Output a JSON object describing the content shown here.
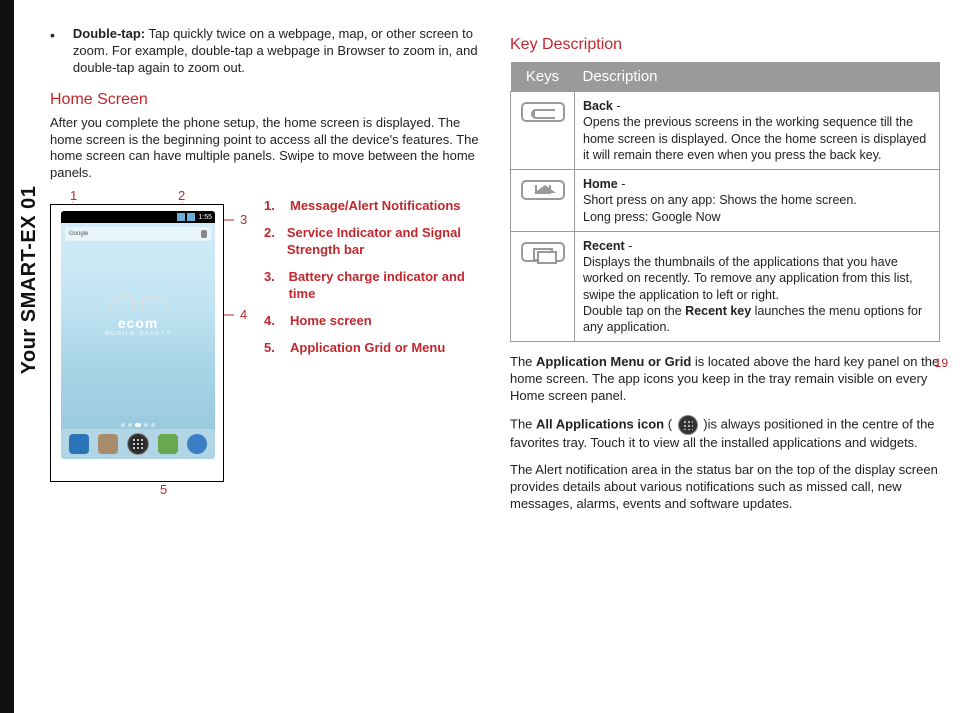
{
  "sidebar_label": "Your SMART-EX 01",
  "page_number": "19",
  "left": {
    "bullet": {
      "label": "Double-tap:",
      "text": " Tap quickly twice on a webpage, map, or other screen to zoom. For example, double-tap a webpage in Browser to zoom in, and double-tap again to zoom out."
    },
    "home_screen_heading": "Home Screen",
    "home_screen_body": "After you complete the phone setup, the home screen is displayed. The home screen is the beginning point to access all the device's features. The home screen can have multiple panels. Swipe to move between the home panels.",
    "callouts": {
      "c1": "1",
      "c2": "2",
      "c3": "3",
      "c4": "4",
      "c5": "5"
    },
    "phone": {
      "google_label": "Google",
      "brand": "ecom",
      "brand_tag": "MOBILE SAFETY",
      "time": "1:55"
    },
    "legend": [
      {
        "num": "1.",
        "text": "Message/Alert Notifications"
      },
      {
        "num": "2.",
        "text": "Service Indicator and Signal Strength bar"
      },
      {
        "num": "3.",
        "text": "Battery charge indicator and time"
      },
      {
        "num": "4.",
        "text": "Home screen"
      },
      {
        "num": "5.",
        "text": "Application Grid or Menu"
      }
    ]
  },
  "right": {
    "heading": "Key Description",
    "table": {
      "head_keys": "Keys",
      "head_desc": "Description",
      "rows": [
        {
          "title": "Back",
          "dash": " - ",
          "body": "Opens the previous screens in the working sequence till the home screen is displayed. Once the home screen is displayed it will remain there even when you press the back key."
        },
        {
          "title": "Home",
          "dash": " - ",
          "body": "Short press on any app: Shows the home screen.",
          "body2": "Long press: Google Now"
        },
        {
          "title": "Recent",
          "dash": " - ",
          "body": "Displays the thumbnails of the applications that you have worked on recently. To remove any application from this list, swipe the application to left or right.",
          "body2a": "Double tap on the ",
          "body2b": "Recent key",
          "body2c": " launches the menu options for any application."
        }
      ]
    },
    "p1a": "The ",
    "p1b": "Application Menu or Grid",
    "p1c": " is located above the hard key panel on the home screen. The app icons you keep in the tray remain visible on every Home screen panel.",
    "p2a": "The ",
    "p2b": "All Applications icon",
    "p2c": " ( ",
    "p2d": " )is always positioned in the centre of the favorites tray. Touch it to view all the installed applications and widgets.",
    "p3": "The Alert notification area in the status bar on the top of the display screen provides details about various notifications such as missed call, new messages, alarms, events and software updates."
  }
}
